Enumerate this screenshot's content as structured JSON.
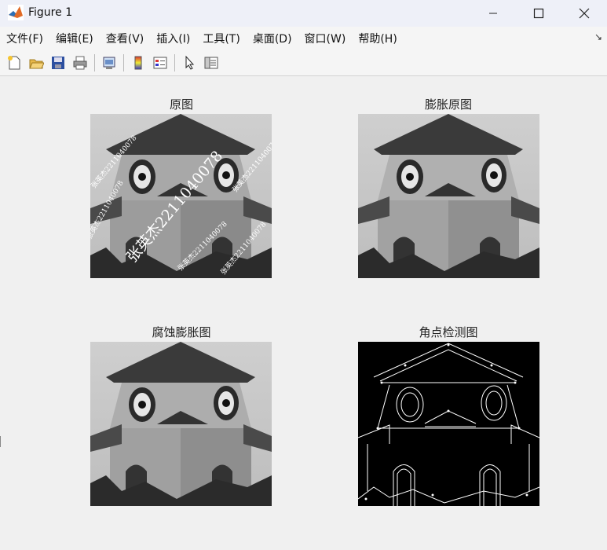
{
  "window": {
    "title": "Figure 1",
    "controls": [
      "minimize",
      "maximize",
      "close"
    ]
  },
  "menubar": {
    "items": [
      "文件(F)",
      "编辑(E)",
      "查看(V)",
      "插入(I)",
      "工具(T)",
      "桌面(D)",
      "窗口(W)",
      "帮助(H)"
    ]
  },
  "toolbar": {
    "icons": [
      "new-figure-icon",
      "open-file-icon",
      "save-icon",
      "print-icon",
      "link-plot-icon",
      "colorbar-icon",
      "legend-icon",
      "pointer-icon",
      "property-editor-icon"
    ]
  },
  "plots": [
    {
      "title": "原图",
      "watermark": "张英杰2211040078"
    },
    {
      "title": "膨胀原图"
    },
    {
      "title": "腐蚀膨胀图"
    },
    {
      "title": "角点检测图"
    }
  ],
  "colors": {
    "titlebar": "#eef0f8",
    "background": "#f0f0f0",
    "matlab_orange": "#e16a26",
    "matlab_blue": "#2c6fb6"
  }
}
